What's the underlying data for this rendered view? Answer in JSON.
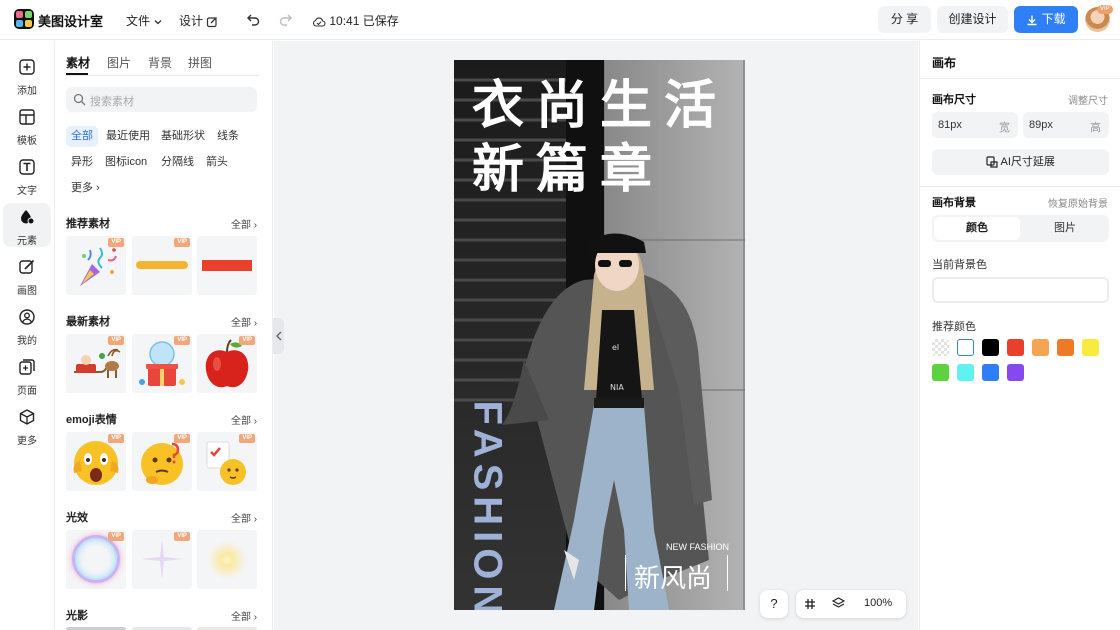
{
  "app": {
    "brand": "美图设计室"
  },
  "topbar": {
    "file_label": "文件",
    "design_label": "设计",
    "save_status": "10:41 已保存",
    "share_label": "分 享",
    "create_label": "创建设计",
    "download_label": "下载",
    "vip_label": "VIP"
  },
  "nav": {
    "items": [
      {
        "label": "添加",
        "icon": "plus-square-icon"
      },
      {
        "label": "模板",
        "icon": "template-icon"
      },
      {
        "label": "文字",
        "icon": "text-icon"
      },
      {
        "label": "元素",
        "icon": "shapes-icon"
      },
      {
        "label": "画图",
        "icon": "draw-icon"
      },
      {
        "label": "我的",
        "icon": "user-icon"
      },
      {
        "label": "页面",
        "icon": "page-add-icon"
      },
      {
        "label": "更多",
        "icon": "cube-icon"
      }
    ],
    "active_index": 3
  },
  "panel": {
    "tabs": [
      "素材",
      "图片",
      "背景",
      "拼图"
    ],
    "search_placeholder": "搜索素材",
    "chips": [
      "全部",
      "最近使用",
      "基础形状",
      "线条",
      "异形",
      "图标icon",
      "分隔线",
      "箭头",
      "更多"
    ],
    "all_label": "全部",
    "vip_label": "VIP",
    "sections": [
      {
        "title": "推荐素材"
      },
      {
        "title": "最新素材"
      },
      {
        "title": "emoji表情"
      },
      {
        "title": "光效"
      },
      {
        "title": "光影"
      }
    ]
  },
  "poster": {
    "title_line1": "衣尚生活",
    "title_line2": "新篇章",
    "vertical_text": "FASHION",
    "new_fashion": "NEW FASHION",
    "sub_title": "新风尚"
  },
  "zoom": {
    "help": "?",
    "level": "100%"
  },
  "right": {
    "title": "画布",
    "size_title": "画布尺寸",
    "adjust_size": "调整尺寸",
    "width_value": "81px",
    "width_unit": "宽",
    "height_value": "89px",
    "height_unit": "高",
    "ai_extend": "AI尺寸延展",
    "bg_title": "画布背景",
    "restore_bg": "恢复原始背景",
    "seg_color": "颜色",
    "seg_image": "图片",
    "current_bg": "当前背景色",
    "recommended": "推荐颜色",
    "swatches": [
      "transparent",
      "#ffffff",
      "#000000",
      "#e8402b",
      "#f5a552",
      "#ef7a26",
      "#f7ec3d",
      "#5ed13f",
      "#5ff2f0",
      "#2f7ef5",
      "#8549f0"
    ]
  }
}
